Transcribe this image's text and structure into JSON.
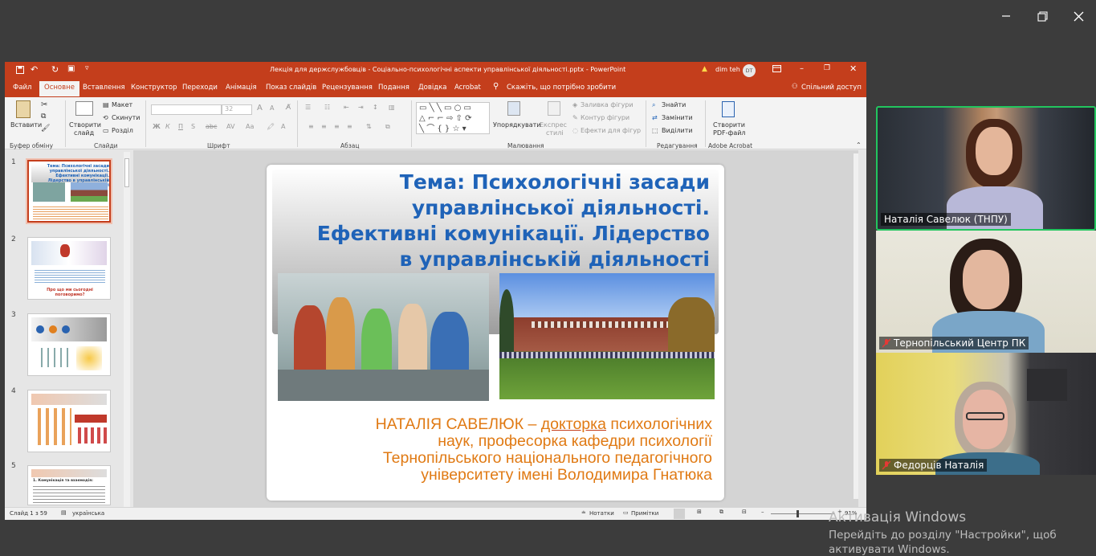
{
  "outer_window": {
    "minimize_icon": "minimize-icon",
    "restore_icon": "restore-icon",
    "close_icon": "close-icon"
  },
  "powerpoint": {
    "title": "Лекція для держслужбовців - Соціально-психологічні аспекти управлінської діяльності.pptx  -  PowerPoint",
    "user_name": "dim teh",
    "user_initials": "DT",
    "warning_icon": "warning-icon",
    "tabs": [
      "Файл",
      "Основне",
      "Вставлення",
      "Конструктор",
      "Переходи",
      "Анімація",
      "Показ слайдів",
      "Рецензування",
      "Подання",
      "Довідка",
      "Acrobat"
    ],
    "active_tab": "Основне",
    "tell_me": "Скажіть, що потрібно зробити",
    "share": "Спільний доступ",
    "ribbon": {
      "paste": "Вставити",
      "new_slide_1": "Створити",
      "new_slide_2": "слайд",
      "layout": "Макет",
      "reset": "Скинути",
      "section": "Розділ",
      "font_size": "32",
      "arrange": "Упорядкувати",
      "styles_1": "Експрес",
      "styles_2": "стилі",
      "shape_fill": "Заливка фігури",
      "shape_outline": "Контур фігури",
      "shape_effects": "Ефекти для фігур",
      "find": "Знайти",
      "replace": "Замінити",
      "select": "Виділити",
      "create_pdf_1": "Створити",
      "create_pdf_2": "PDF-файл",
      "groups": [
        "Буфер обміну",
        "Слайди",
        "Шрифт",
        "Абзац",
        "Малювання",
        "Редагування",
        "Adobe Acrobat"
      ]
    },
    "thumbnails": [
      {
        "num": "1",
        "title": "Тема: Психологічні засади управлінської діяльності. Ефективні комунікації. Лідерство в управлінській діяльності"
      },
      {
        "num": "2",
        "title": "Про що ми сьогодні поговоримо?"
      },
      {
        "num": "3",
        "title": ""
      },
      {
        "num": "4",
        "title": ""
      },
      {
        "num": "5",
        "title": "1. Комунікація та взаємодія:"
      }
    ],
    "slide": {
      "title_lines": [
        "Тема: Психологічні засади",
        "управлінської діяльності.",
        "Ефективні комунікації. Лідерство",
        "в управлінській діяльності"
      ],
      "subtitle_prefix": "НАТАЛІЯ САВЕЛЮК – ",
      "subtitle_underlined": "докторка",
      "subtitle_rest_1": " психологічних",
      "subtitle_line2": "наук, професорка кафедри психології",
      "subtitle_line3": "Тернопільського національного педагогічного",
      "subtitle_line4": "університету імені Володимира Гнатюка"
    },
    "status": {
      "slide_counter": "Слайд 1 з 59",
      "language": "українська",
      "notes": "Нотатки",
      "comments": "Примітки",
      "zoom": "91%"
    }
  },
  "participants": [
    {
      "name": "Наталія Савелюк (ТНПУ)",
      "muted": false,
      "active_speaker": true
    },
    {
      "name": "Тернопільський Центр ПК",
      "muted": true,
      "active_speaker": false
    },
    {
      "name": "Федорців Наталія",
      "muted": true,
      "active_speaker": false
    }
  ],
  "activation": {
    "title": "Активація Windows",
    "line1": "Перейдіть до розділу \"Настройки\", щоб",
    "line2": "активувати Windows."
  },
  "colors": {
    "ppt_accent": "#c43e1c",
    "title_blue": "#1f63b8",
    "subtitle_orange": "#e07a14",
    "active_speaker_border": "#22c55e"
  }
}
